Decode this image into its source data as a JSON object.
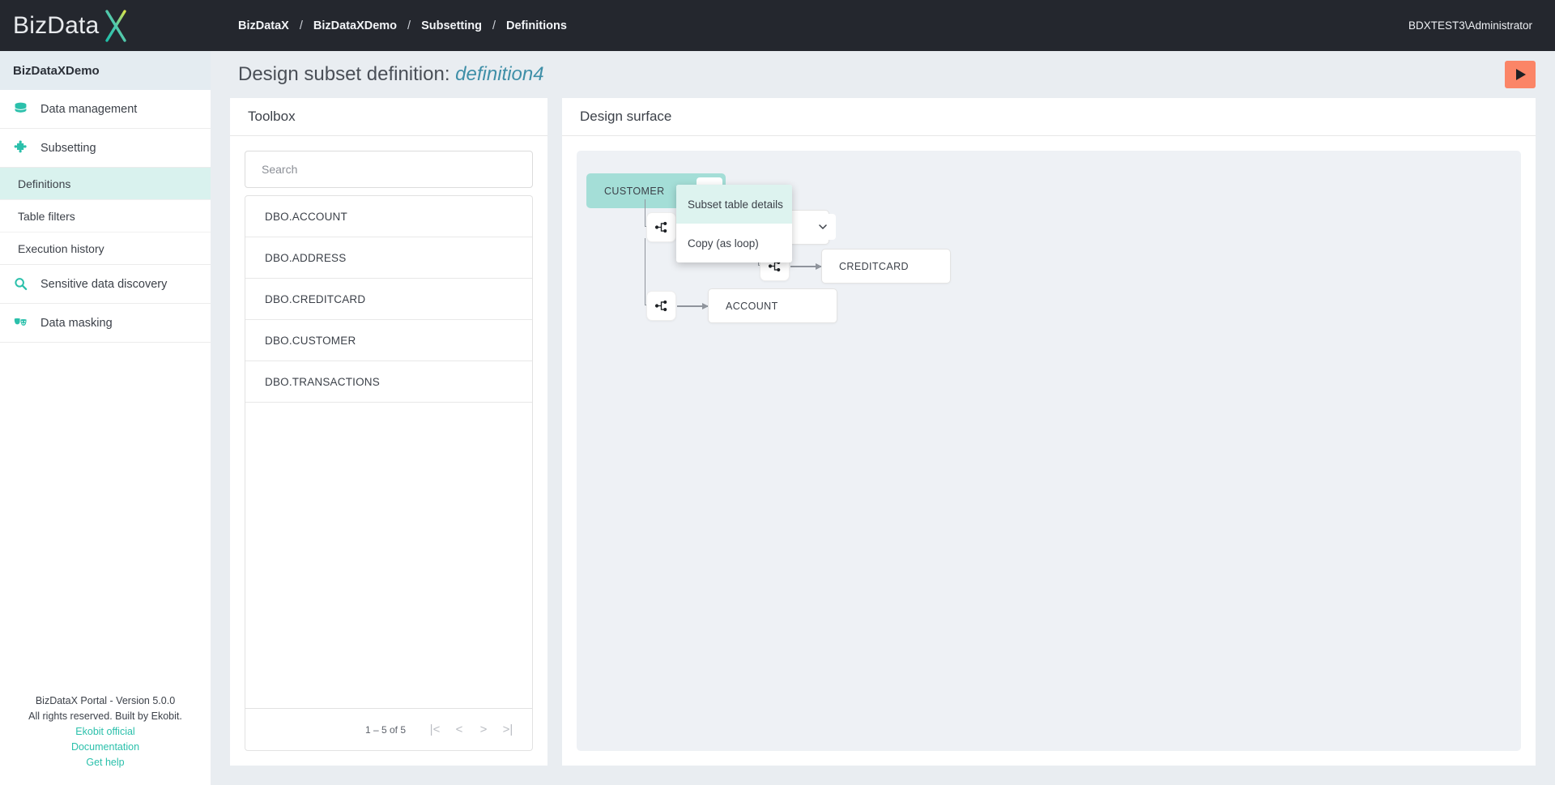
{
  "brand": {
    "logo_text": "BizData",
    "logo_accent_letter": "X",
    "tenant": "BizDataXDemo"
  },
  "colors": {
    "header_bg": "#24272e",
    "accent_teal": "#2bc0ab",
    "node_selected": "#a4ded7",
    "menu_highlight": "#ddf3ef",
    "run_button": "#fb8567",
    "surface_bg": "#eef1f5",
    "title_link": "#3f8fa8"
  },
  "topbar": {
    "breadcrumbs": [
      {
        "label": "BizDataX"
      },
      {
        "label": "BizDataXDemo"
      },
      {
        "label": "Subsetting"
      },
      {
        "label": "Definitions"
      }
    ],
    "separator": "/",
    "user": "BDXTEST3\\Administrator"
  },
  "sidebar": {
    "items": [
      {
        "label": "Data management",
        "icon": "database-icon",
        "type": "group"
      },
      {
        "label": "Subsetting",
        "icon": "puzzle-icon",
        "type": "group"
      },
      {
        "label": "Definitions",
        "type": "sub",
        "active": true
      },
      {
        "label": "Table filters",
        "type": "sub",
        "active": false
      },
      {
        "label": "Execution history",
        "type": "sub",
        "active": false
      },
      {
        "label": "Sensitive data discovery",
        "icon": "magnifier-icon",
        "type": "group"
      },
      {
        "label": "Data masking",
        "icon": "masks-icon",
        "type": "group"
      }
    ],
    "footer": {
      "version": "BizDataX Portal - Version 5.0.0",
      "rights": "All rights reserved. Built by Ekobit.",
      "links": [
        {
          "label": "Ekobit official"
        },
        {
          "label": "Documentation"
        },
        {
          "label": "Get help"
        }
      ]
    }
  },
  "page": {
    "title_prefix": "Design subset definition:",
    "title_name": "definition4",
    "run_button_label": "Run"
  },
  "toolbox": {
    "heading": "Toolbox",
    "search": {
      "value": "",
      "placeholder": "Search"
    },
    "tables": [
      {
        "name": "DBO.ACCOUNT"
      },
      {
        "name": "DBO.ADDRESS"
      },
      {
        "name": "DBO.CREDITCARD"
      },
      {
        "name": "DBO.CUSTOMER"
      },
      {
        "name": "DBO.TRANSACTIONS"
      }
    ],
    "pager": {
      "range": "1 – 5 of 5",
      "first": "|<",
      "prev": "<",
      "next": ">",
      "last": ">|"
    }
  },
  "design": {
    "heading": "Design surface",
    "nodes": [
      {
        "name": "CUSTOMER",
        "selected": true
      },
      {
        "name": "CREDITCARD",
        "selected": false
      },
      {
        "name": "ACCOUNT",
        "selected": false
      }
    ]
  },
  "context_menu": {
    "items": [
      {
        "label": "Subset table details",
        "highlighted": true
      },
      {
        "label": "Copy (as loop)",
        "highlighted": false
      }
    ]
  }
}
